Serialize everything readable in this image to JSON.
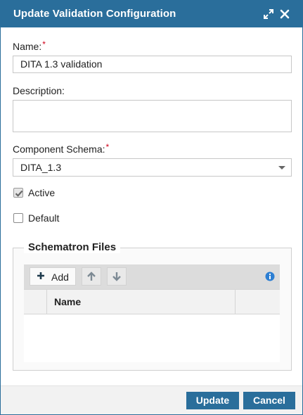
{
  "dialog": {
    "title": "Update Validation Configuration",
    "icons": {
      "expand": "expand-icon",
      "close": "close-icon"
    }
  },
  "form": {
    "name": {
      "label": "Name:",
      "required_mark": "*",
      "value": "DITA 1.3 validation"
    },
    "description": {
      "label": "Description:",
      "value": ""
    },
    "component_schema": {
      "label": "Component Schema:",
      "required_mark": "*",
      "value": "DITA_1.3"
    },
    "active": {
      "label": "Active",
      "checked": true
    },
    "default": {
      "label": "Default",
      "checked": false
    }
  },
  "schematron": {
    "legend": "Schematron Files",
    "toolbar": {
      "add_label": "Add",
      "icons": [
        "plus-icon",
        "arrow-up-icon",
        "arrow-down-icon",
        "info-icon"
      ]
    },
    "columns": [
      "",
      "Name",
      ""
    ],
    "rows": []
  },
  "footer": {
    "update_label": "Update",
    "cancel_label": "Cancel"
  },
  "colors": {
    "primary": "#2a6e9b",
    "required": "#d0021b",
    "info": "#2d7fd3"
  }
}
